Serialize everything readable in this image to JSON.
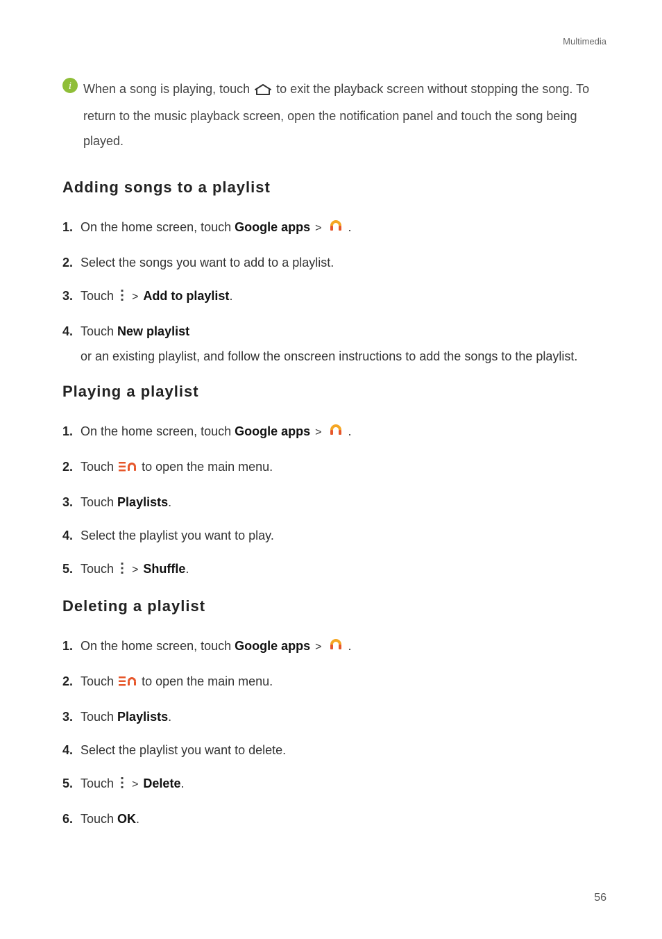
{
  "header": {
    "section": "Multimedia"
  },
  "info": {
    "pre": "When a song is playing, touch ",
    "post": "to exit the playback screen without stopping the song. To return to the music playback screen, open the notification panel and touch the song being played."
  },
  "sections": {
    "adding": {
      "title": "Adding songs to a playlist",
      "s1a": "On the home screen, touch ",
      "s1b": "Google apps",
      "s1c": " .",
      "s2": "Select the songs you want to add to a playlist.",
      "s3a": "Touch ",
      "s3b": "Add to playlist",
      "s3c": ".",
      "s4a": "Touch ",
      "s4b": "New playlist",
      "s4c": " or an existing playlist, and follow the onscreen instructions to add the songs to the playlist."
    },
    "playing": {
      "title": "Playing a playlist",
      "s1a": "On the home screen, touch ",
      "s1b": "Google apps",
      "s1c": " .",
      "s2a": "Touch ",
      "s2b": "to open the main menu.",
      "s3a": "Touch ",
      "s3b": "Playlists",
      "s3c": ".",
      "s4": "Select the playlist you want to play.",
      "s5a": "Touch ",
      "s5b": "Shuffle",
      "s5c": "."
    },
    "deleting": {
      "title": "Deleting a playlist",
      "s1a": "On the home screen, touch ",
      "s1b": "Google apps",
      "s1c": " .",
      "s2a": "Touch ",
      "s2b": "to open the main menu.",
      "s3a": "Touch ",
      "s3b": "Playlists",
      "s3c": ".",
      "s4": "Select the playlist you want to delete.",
      "s5a": "Touch ",
      "s5b": "Delete",
      "s5c": ".",
      "s6a": "Touch ",
      "s6b": "OK",
      "s6c": "."
    }
  },
  "page": "56",
  "gt": ">"
}
